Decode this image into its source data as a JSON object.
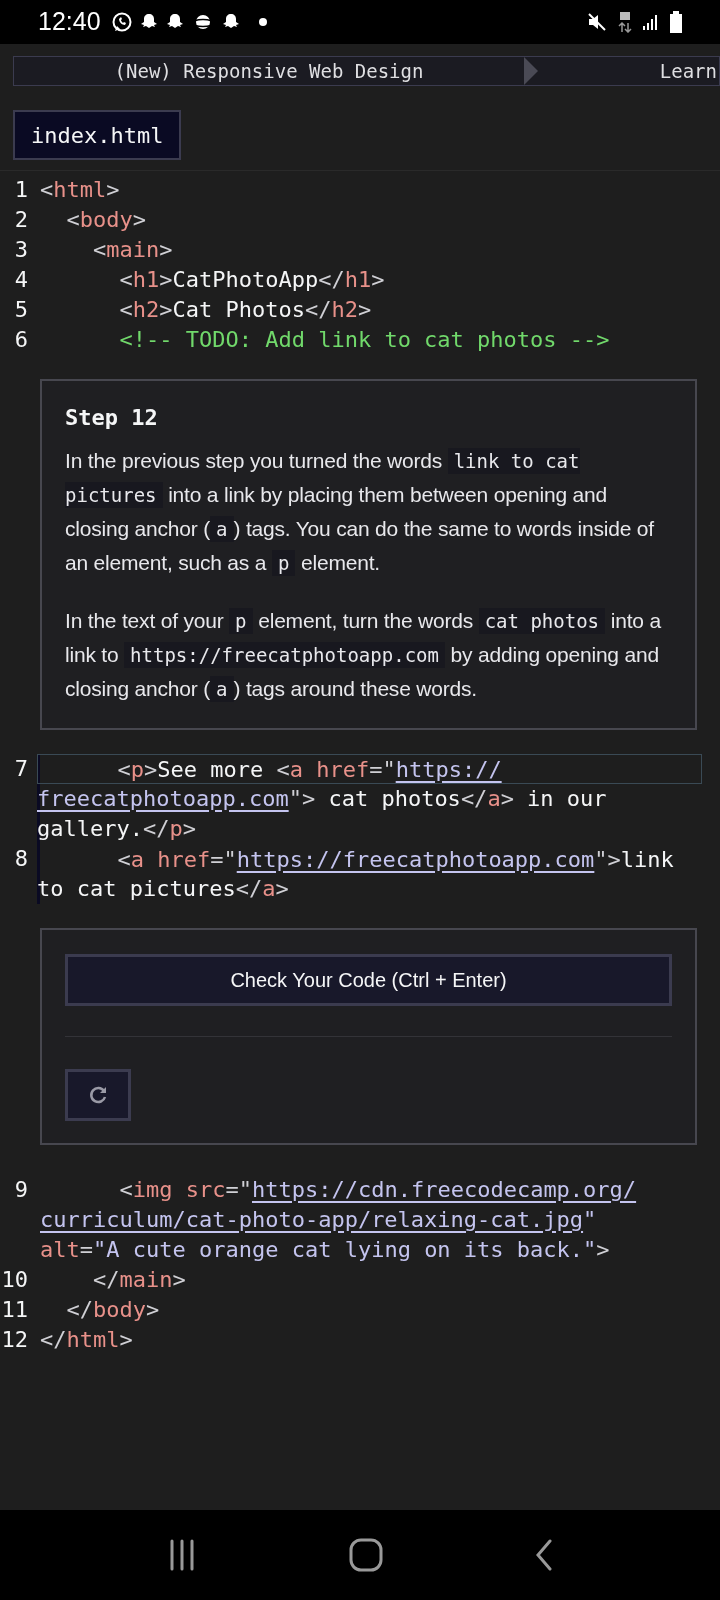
{
  "status_bar": {
    "time": "12:40"
  },
  "breadcrumb": [
    "(New) Responsive Web Design",
    "Learn"
  ],
  "file_tabs": [
    {
      "label": "index.html",
      "selected": true
    }
  ],
  "code_top": [
    {
      "number": "1",
      "rows": [
        "<html>"
      ]
    },
    {
      "number": "2",
      "rows": [
        "  <body>"
      ]
    },
    {
      "number": "3",
      "rows": [
        "    <main>"
      ]
    },
    {
      "number": "4",
      "rows": [
        "      <h1>CatPhotoApp</h1>"
      ]
    },
    {
      "number": "5",
      "rows": [
        "      <h2>Cat Photos</h2>"
      ]
    },
    {
      "number": "6",
      "rows": [
        "      <!-- TODO: Add link to cat photos -->"
      ]
    }
  ],
  "step": {
    "title": "Step 12",
    "paragraphs": [
      [
        "In the previous step you turned the words ",
        "link to cat pictures",
        " into a link by placing them between opening and closing anchor (",
        "a",
        ") tags. You can do the same to words inside of an element, such as a ",
        "p",
        " element."
      ],
      [
        "In the text of your ",
        "p",
        " element, turn the words ",
        "cat photos",
        " into a link to ",
        "https://freecatphotoapp.com",
        " by adding opening and closing anchor (",
        "a",
        ") tags around these words."
      ]
    ]
  },
  "code_middle": [
    {
      "number": "7",
      "active": true,
      "rows": [
        "      <p>See more <a href=\"https://",
        "freecatphotoapp.com\"> cat photos</a> in our",
        "gallery.</p>"
      ]
    },
    {
      "number": "8",
      "active": false,
      "rows": [
        "      <a href=\"https://freecatphotoapp.com\">link",
        "to cat pictures</a>"
      ]
    }
  ],
  "check": {
    "button": "Check Your Code (Ctrl + Enter)"
  },
  "code_bottom": [
    {
      "number": "9",
      "rows": [
        "      <img src=\"https://cdn.freecodecamp.org/",
        "curriculum/cat-photo-app/relaxing-cat.jpg\"",
        "alt=\"A cute orange cat lying on its back.\">"
      ]
    },
    {
      "number": "10",
      "rows": [
        "    </main>"
      ]
    },
    {
      "number": "11",
      "rows": [
        "  </body>"
      ]
    },
    {
      "number": "12",
      "rows": [
        "</html>"
      ]
    }
  ]
}
